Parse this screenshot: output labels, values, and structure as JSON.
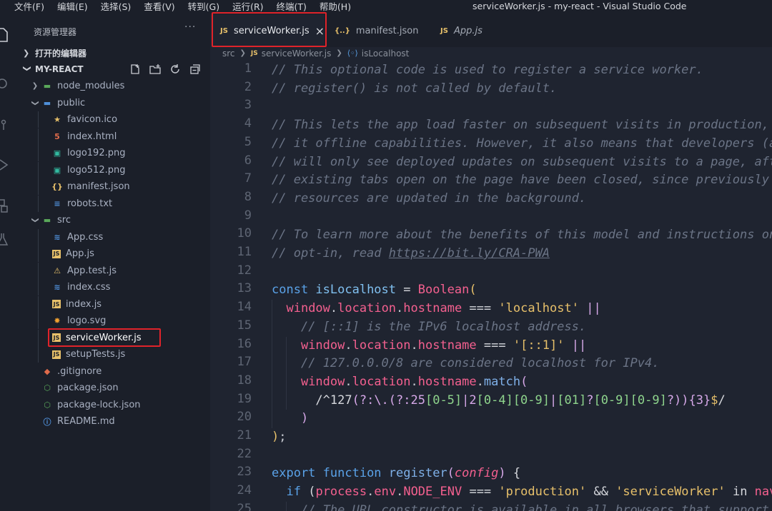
{
  "menu": [
    "文件(F)",
    "编辑(E)",
    "选择(S)",
    "查看(V)",
    "转到(G)",
    "运行(R)",
    "终端(T)",
    "帮助(H)"
  ],
  "window_title": "serviceWorker.js - my-react - Visual Studio Code",
  "sidebar": {
    "title": "资源管理器",
    "more": "···",
    "open_editors": "打开的编辑器",
    "project": "MY-REACT",
    "tree": [
      {
        "label": "node_modules",
        "icon": "folder-node-icon",
        "kind": "folder",
        "depth": 1,
        "color": "#a9b1c2"
      },
      {
        "label": "public",
        "icon": "folder-public-icon",
        "kind": "folder-open",
        "depth": 1,
        "color": "#a9b1c2"
      },
      {
        "label": "favicon.ico",
        "icon": "star-icon",
        "kind": "file",
        "depth": 2,
        "color": "#e7c06a"
      },
      {
        "label": "index.html",
        "icon": "html5-icon",
        "kind": "file",
        "depth": 2,
        "color": "#e06b4b"
      },
      {
        "label": "logo192.png",
        "icon": "image-icon",
        "kind": "file",
        "depth": 2,
        "color": "#32b9a0"
      },
      {
        "label": "logo512.png",
        "icon": "image-icon",
        "kind": "file",
        "depth": 2,
        "color": "#32b9a0"
      },
      {
        "label": "manifest.json",
        "icon": "json-braces-icon",
        "kind": "file",
        "depth": 2,
        "color": "#e7c06a"
      },
      {
        "label": "robots.txt",
        "icon": "text-file-icon",
        "kind": "file",
        "depth": 2,
        "color": "#4f8fd8"
      },
      {
        "label": "src",
        "icon": "folder-src-icon",
        "kind": "folder-open",
        "depth": 1,
        "color": "#a9b1c2"
      },
      {
        "label": "App.css",
        "icon": "css-icon",
        "kind": "file",
        "depth": 2,
        "color": "#4f8fd8"
      },
      {
        "label": "App.js",
        "icon": "js-icon",
        "kind": "file",
        "depth": 2,
        "color": "#e7c06a"
      },
      {
        "label": "App.test.js",
        "icon": "test-flask-icon",
        "kind": "file",
        "depth": 2,
        "color": "#e7c06a"
      },
      {
        "label": "index.css",
        "icon": "css-icon",
        "kind": "file",
        "depth": 2,
        "color": "#4f8fd8"
      },
      {
        "label": "index.js",
        "icon": "js-icon",
        "kind": "file",
        "depth": 2,
        "color": "#e7c06a"
      },
      {
        "label": "logo.svg",
        "icon": "svg-sun-icon",
        "kind": "file",
        "depth": 2,
        "color": "#f0a030"
      },
      {
        "label": "serviceWorker.js",
        "icon": "js-icon",
        "kind": "file",
        "depth": 2,
        "color": "#ffffff",
        "selected": true
      },
      {
        "label": "setupTests.js",
        "icon": "js-icon",
        "kind": "file",
        "depth": 2,
        "color": "#e7c06a"
      },
      {
        "label": ".gitignore",
        "icon": "git-icon",
        "kind": "file",
        "depth": 1,
        "color": "#e06b4b"
      },
      {
        "label": "package.json",
        "icon": "npm-package-icon",
        "kind": "file",
        "depth": 1,
        "color": "#5aa85a"
      },
      {
        "label": "package-lock.json",
        "icon": "npm-package-icon",
        "kind": "file",
        "depth": 1,
        "color": "#5aa85a"
      },
      {
        "label": "README.md",
        "icon": "info-icon",
        "kind": "file",
        "depth": 1,
        "color": "#4f8fd8"
      }
    ]
  },
  "tabs": [
    {
      "label": "serviceWorker.js",
      "icon": "js-icon",
      "active": true,
      "close": "×"
    },
    {
      "label": "manifest.json",
      "icon": "json-braces-icon",
      "active": false
    },
    {
      "label": "App.js",
      "icon": "js-icon",
      "active": false,
      "italic": true
    }
  ],
  "breadcrumb": {
    "folder": "src",
    "file": "serviceWorker.js",
    "symbol": "isLocalhost"
  },
  "line_numbers": [
    "1",
    "2",
    "3",
    "4",
    "5",
    "6",
    "7",
    "8",
    "9",
    "10",
    "11",
    "12",
    "13",
    "14",
    "15",
    "16",
    "17",
    "18",
    "19",
    "20",
    "21",
    "22",
    "23",
    "24",
    "25"
  ],
  "code": [
    [
      [
        "cm",
        "// This optional code is used to register a service worker."
      ]
    ],
    [
      [
        "cm",
        "// register() is not called by default."
      ]
    ],
    [],
    [
      [
        "cm",
        "// This lets the app load faster on subsequent visits in production, and gives"
      ]
    ],
    [
      [
        "cm",
        "// it offline capabilities. However, it also means that developers (and users)"
      ]
    ],
    [
      [
        "cm",
        "// will only see deployed updates on subsequent visits to a page, after all the"
      ]
    ],
    [
      [
        "cm",
        "// existing tabs open on the page have been closed, since previously cached"
      ]
    ],
    [
      [
        "cm",
        "// resources are updated in the background."
      ]
    ],
    [],
    [
      [
        "cm",
        "// To learn more about the benefits of this model and instructions on how to"
      ]
    ],
    [
      [
        "cm",
        "// opt-in, read "
      ],
      [
        "url",
        "https://bit.ly/CRA-PWA"
      ]
    ],
    [],
    [
      [
        "kw",
        "const "
      ],
      [
        "id",
        "isLocalhost"
      ],
      [
        "op",
        " = "
      ],
      [
        "prop",
        "Boolean"
      ],
      [
        "brk",
        "("
      ]
    ],
    [
      [
        "plain",
        "  "
      ],
      [
        "prop",
        "window"
      ],
      [
        "punc",
        "."
      ],
      [
        "prop",
        "location"
      ],
      [
        "punc",
        "."
      ],
      [
        "prop",
        "hostname"
      ],
      [
        "op",
        " === "
      ],
      [
        "str",
        "'localhost'"
      ],
      [
        "op",
        " "
      ],
      [
        "rx",
        "||"
      ]
    ],
    [
      [
        "plain",
        "    "
      ],
      [
        "cm",
        "// [::1] is the IPv6 localhost address."
      ]
    ],
    [
      [
        "plain",
        "    "
      ],
      [
        "prop",
        "window"
      ],
      [
        "punc",
        "."
      ],
      [
        "prop",
        "location"
      ],
      [
        "punc",
        "."
      ],
      [
        "prop",
        "hostname"
      ],
      [
        "op",
        " === "
      ],
      [
        "str",
        "'[::1]'"
      ],
      [
        "op",
        " "
      ],
      [
        "rx",
        "||"
      ]
    ],
    [
      [
        "plain",
        "    "
      ],
      [
        "cm",
        "// 127.0.0.0/8 are considered localhost for IPv4."
      ]
    ],
    [
      [
        "plain",
        "    "
      ],
      [
        "prop",
        "window"
      ],
      [
        "punc",
        "."
      ],
      [
        "prop",
        "location"
      ],
      [
        "punc",
        "."
      ],
      [
        "prop",
        "hostname"
      ],
      [
        "punc",
        "."
      ],
      [
        "fn",
        "match"
      ],
      [
        "rx",
        "("
      ]
    ],
    [
      [
        "plain",
        "      "
      ],
      [
        "op",
        "/^127"
      ],
      [
        "rx",
        "(?:\\.(?:25"
      ],
      [
        "rxc",
        "[0-5]"
      ],
      [
        "rx",
        "|2"
      ],
      [
        "rxc",
        "[0-4][0-9]"
      ],
      [
        "rx",
        "|"
      ],
      [
        "rxc",
        "[01]"
      ],
      [
        "rx",
        "?"
      ],
      [
        "rxc",
        "[0-9][0-9]"
      ],
      [
        "rx",
        "?)){3}"
      ],
      [
        "str",
        "$"
      ],
      [
        "op",
        "/"
      ]
    ],
    [
      [
        "plain",
        "    "
      ],
      [
        "rx",
        ")"
      ]
    ],
    [
      [
        "brk",
        ")"
      ],
      [
        "punc",
        ";"
      ]
    ],
    [],
    [
      [
        "kw",
        "export "
      ],
      [
        "kw",
        "function "
      ],
      [
        "fn",
        "register"
      ],
      [
        "rx",
        "("
      ],
      [
        "param",
        "config"
      ],
      [
        "rx",
        ")"
      ],
      [
        "op",
        " {"
      ]
    ],
    [
      [
        "plain",
        "  "
      ],
      [
        "kw",
        "if "
      ],
      [
        "op",
        "("
      ],
      [
        "prop",
        "process"
      ],
      [
        "punc",
        "."
      ],
      [
        "prop",
        "env"
      ],
      [
        "punc",
        "."
      ],
      [
        "prop",
        "NODE_ENV"
      ],
      [
        "op",
        " === "
      ],
      [
        "str",
        "'production'"
      ],
      [
        "op",
        " && "
      ],
      [
        "str",
        "'serviceWorker'"
      ],
      [
        "op",
        " in "
      ],
      [
        "prop",
        "navigator"
      ],
      [
        "op",
        ") {"
      ]
    ],
    [
      [
        "plain",
        "    "
      ],
      [
        "cm",
        "// The URL constructor is available in all browsers that support SW."
      ]
    ]
  ],
  "colors": {
    "accent_highlight": "#e0232a",
    "editor_bg": "#1f2430",
    "sidebar_bg": "#1b1f29"
  }
}
